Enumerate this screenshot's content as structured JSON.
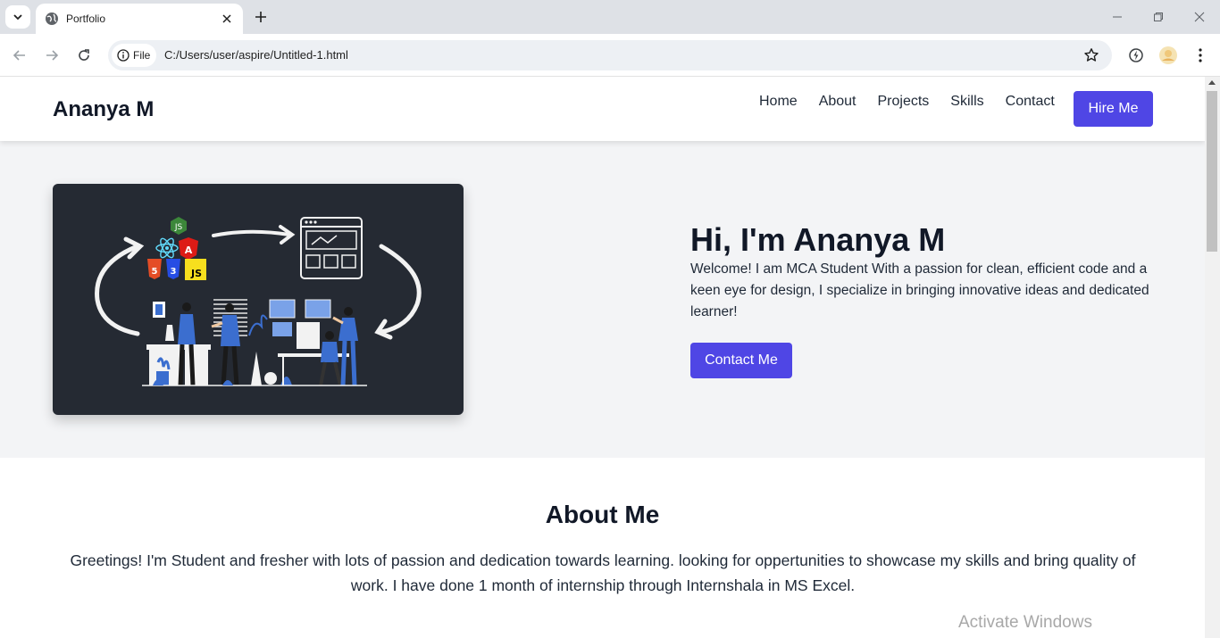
{
  "browser": {
    "tab_title": "Portfolio",
    "chip_label": "File",
    "url": "C:/Users/user/aspire/Untitled-1.html"
  },
  "site": {
    "logo": "Ananya M",
    "nav": [
      "Home",
      "About",
      "Projects",
      "Skills",
      "Contact"
    ],
    "hire_label": "Hire Me",
    "accent_color": "#4f46e5"
  },
  "hero": {
    "title": "Hi, I'm Ananya M",
    "text": "Welcome! I am MCA Student With a passion for clean, efficient code and a keen eye for design, I specialize in bringing innovative ideas and dedicated learner!",
    "button_label": "Contact Me",
    "image_badges": {
      "js": "JS",
      "angular": "A",
      "html": "5",
      "css": "3",
      "js_tile": "JS"
    }
  },
  "about": {
    "title": "About Me",
    "text": "Greetings! I'm Student and fresher with lots of passion and dedication towards learning. looking for oppertunities to showcase my skills and bring quality of work. I have done 1 month of internship through Internshala in MS Excel."
  },
  "overlay": {
    "watermark": "Activate Windows"
  }
}
